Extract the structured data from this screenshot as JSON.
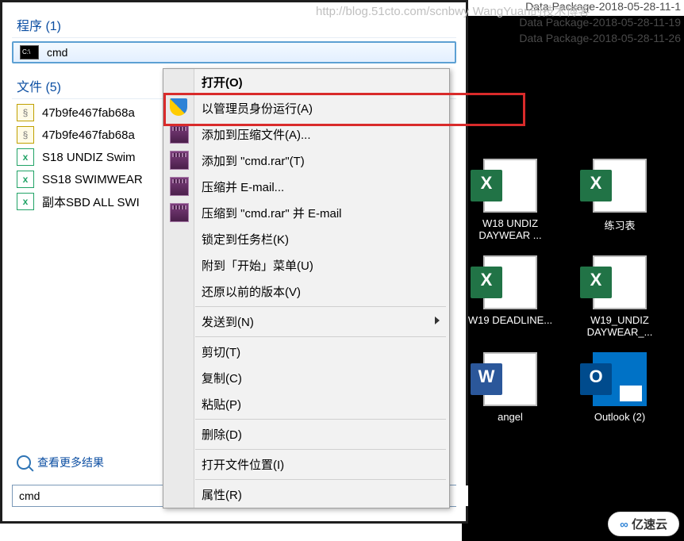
{
  "watermark": "http://blog.51cto.com/scnbwy WangYuan的技术博客",
  "top_lines": [
    "Data Package-2018-05-28-11-1",
    "Data Package-2018-05-28-11-19",
    "Data Package-2018-05-28-11-26"
  ],
  "search": {
    "programs_heading": "程序 (1)",
    "files_heading": "文件 (5)",
    "cmd_label": "cmd",
    "file_items": [
      "47b9fe467fab68a",
      "47b9fe467fab68a",
      "S18 UNDIZ Swim",
      "SS18 SWIMWEAR",
      "副本SBD ALL SWI"
    ],
    "see_more": "查看更多结果",
    "input_value": "cmd"
  },
  "context_menu": {
    "items": [
      {
        "label": "打开(O)",
        "icon": null,
        "bold": true
      },
      {
        "label": "以管理员身份运行(A)",
        "icon": "shield"
      },
      {
        "label": "添加到压缩文件(A)...",
        "icon": "rar"
      },
      {
        "label": "添加到 \"cmd.rar\"(T)",
        "icon": "rar"
      },
      {
        "label": "压缩并 E-mail...",
        "icon": "rar"
      },
      {
        "label": "压缩到 \"cmd.rar\" 并 E-mail",
        "icon": "rar"
      },
      {
        "label": "锁定到任务栏(K)",
        "icon": null
      },
      {
        "label": "附到「开始」菜单(U)",
        "icon": null
      },
      {
        "label": "还原以前的版本(V)",
        "icon": null
      },
      {
        "sep": true
      },
      {
        "label": "发送到(N)",
        "icon": null,
        "submenu": true
      },
      {
        "sep": true
      },
      {
        "label": "剪切(T)",
        "icon": null
      },
      {
        "label": "复制(C)",
        "icon": null
      },
      {
        "label": "粘贴(P)",
        "icon": null
      },
      {
        "sep": true
      },
      {
        "label": "删除(D)",
        "icon": null
      },
      {
        "sep": true
      },
      {
        "label": "打开文件位置(I)",
        "icon": null
      },
      {
        "sep": true
      },
      {
        "label": "属性(R)",
        "icon": null
      }
    ]
  },
  "desktop": {
    "files": [
      {
        "name": "W18 UNDIZ DAYWEAR ...",
        "type": "excel"
      },
      {
        "name": "练习表",
        "type": "excel"
      },
      {
        "name": "W19 DEADLINE...",
        "type": "excel"
      },
      {
        "name": "W19_UNDIZ DAYWEAR_...",
        "type": "excel"
      },
      {
        "name": "angel",
        "type": "word"
      },
      {
        "name": "Outlook (2)",
        "type": "outlook"
      }
    ]
  },
  "logo": "亿速云"
}
